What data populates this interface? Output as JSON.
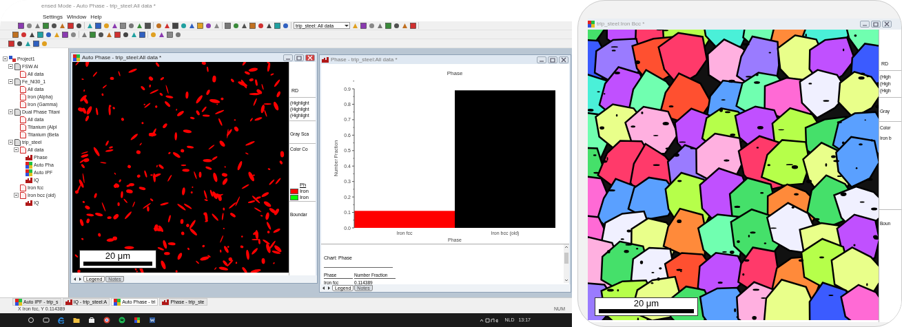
{
  "left_screen": {
    "title": "ensed Mode - Auto Phase - trip_steel:All data *",
    "menu": [
      "Settings",
      "Window",
      "Help"
    ],
    "dataset_dropdown": "trip_steel: All data",
    "project_tree": [
      {
        "label": "Project1",
        "kind": "project",
        "children": [
          {
            "label": "FSW Al",
            "kind": "dataset",
            "children": [
              {
                "label": "All data",
                "kind": "partition"
              }
            ]
          },
          {
            "label": "Fe_Ni30_1",
            "kind": "dataset",
            "children": [
              {
                "label": "All data",
                "kind": "partition"
              },
              {
                "label": "Iron (Alpha)",
                "kind": "partition"
              },
              {
                "label": "Iron (Gamma)",
                "kind": "partition"
              }
            ]
          },
          {
            "label": "Dual Phase Titani",
            "kind": "dataset",
            "children": [
              {
                "label": "All data",
                "kind": "partition"
              },
              {
                "label": "Titanium (Alpl",
                "kind": "partition"
              },
              {
                "label": "Titanium (Beta",
                "kind": "partition"
              }
            ]
          },
          {
            "label": "trip_steel",
            "kind": "dataset",
            "children": [
              {
                "label": "All data",
                "kind": "partition",
                "children": [
                  {
                    "label": "Phase",
                    "kind": "chart"
                  },
                  {
                    "label": "Auto Pha",
                    "kind": "map"
                  },
                  {
                    "label": "Auto IPF",
                    "kind": "map"
                  },
                  {
                    "label": "IQ",
                    "kind": "chart"
                  }
                ]
              },
              {
                "label": "Iron fcc",
                "kind": "partition"
              },
              {
                "label": "Iron bcc (old)",
                "kind": "partition",
                "children": [
                  {
                    "label": "IQ",
                    "kind": "chart"
                  }
                ]
              }
            ]
          }
        ]
      }
    ],
    "map_window": {
      "title": "Auto Phase - trip_steel:All data *",
      "scale_bar": "20 μm",
      "side_panel": {
        "axis_label": "RD",
        "highlights": [
          "(Highlight",
          "(Highlight",
          "(Highlight"
        ],
        "gray_scale": "Gray Sca",
        "color_coding": "Color Co",
        "legend_header": "Ph",
        "legend": [
          {
            "label": "Iron",
            "color": "#ff0000"
          },
          {
            "label": "Iron",
            "color": "#00ff00"
          }
        ],
        "boundaries": "Boundar"
      },
      "tabs": [
        {
          "label": "Legend",
          "selected": true
        },
        {
          "label": "Notes",
          "selected": false
        }
      ]
    },
    "chart_window": {
      "title": "Phase - trip_steel:All data *",
      "chart_data": {
        "type": "bar",
        "title": "Phase",
        "xlabel": "Phase",
        "ylabel": "Number Fraction",
        "ylim": [
          0,
          0.9
        ],
        "yticks": [
          {
            "value": 0,
            "label": "0.0"
          },
          0.1,
          0.2,
          0.3,
          0.4,
          0.5,
          0.6,
          0.7,
          0.8,
          0.9
        ],
        "series": [
          {
            "name": "Iron fcc",
            "color": "#ff0000",
            "values": [
              0.11
            ]
          },
          {
            "name": "Iron bcc (old)",
            "color": "#000000",
            "values": [
              0.89
            ]
          }
        ]
      },
      "text_panel": {
        "heading": "Chart: Phase",
        "columns": [
          "Phase",
          "Number Fraction"
        ],
        "rows": [
          [
            "Iron fcc",
            "0.114389"
          ]
        ]
      },
      "tabs": [
        {
          "label": "Legend",
          "selected": true
        },
        {
          "label": "Notes",
          "selected": false
        }
      ]
    },
    "document_tabs": [
      {
        "label": "Auto IPF - trip_s",
        "kind": "map",
        "selected": false
      },
      {
        "label": "IQ - trip_steel:A",
        "kind": "chart",
        "selected": false
      },
      {
        "label": "Auto Phase - tri",
        "kind": "map",
        "selected": true
      },
      {
        "label": "Phase - trip_ste",
        "kind": "chart",
        "selected": false
      }
    ],
    "status": "X Iron fcc, Y 0.114389",
    "status_indicator": "NUM",
    "taskbar": {
      "language": "NLD",
      "time": "13:17"
    }
  },
  "right_screen": {
    "title": "trip_steel:Iron Bcc *",
    "scale_bar": "20 μm",
    "side_panel": {
      "axis_label": "RD",
      "highlights": [
        "(High",
        "(High",
        "(High"
      ],
      "gray_scale": "Gray",
      "color_coding": "Color",
      "phase": "Iron b",
      "boundaries": "Boun"
    }
  }
}
